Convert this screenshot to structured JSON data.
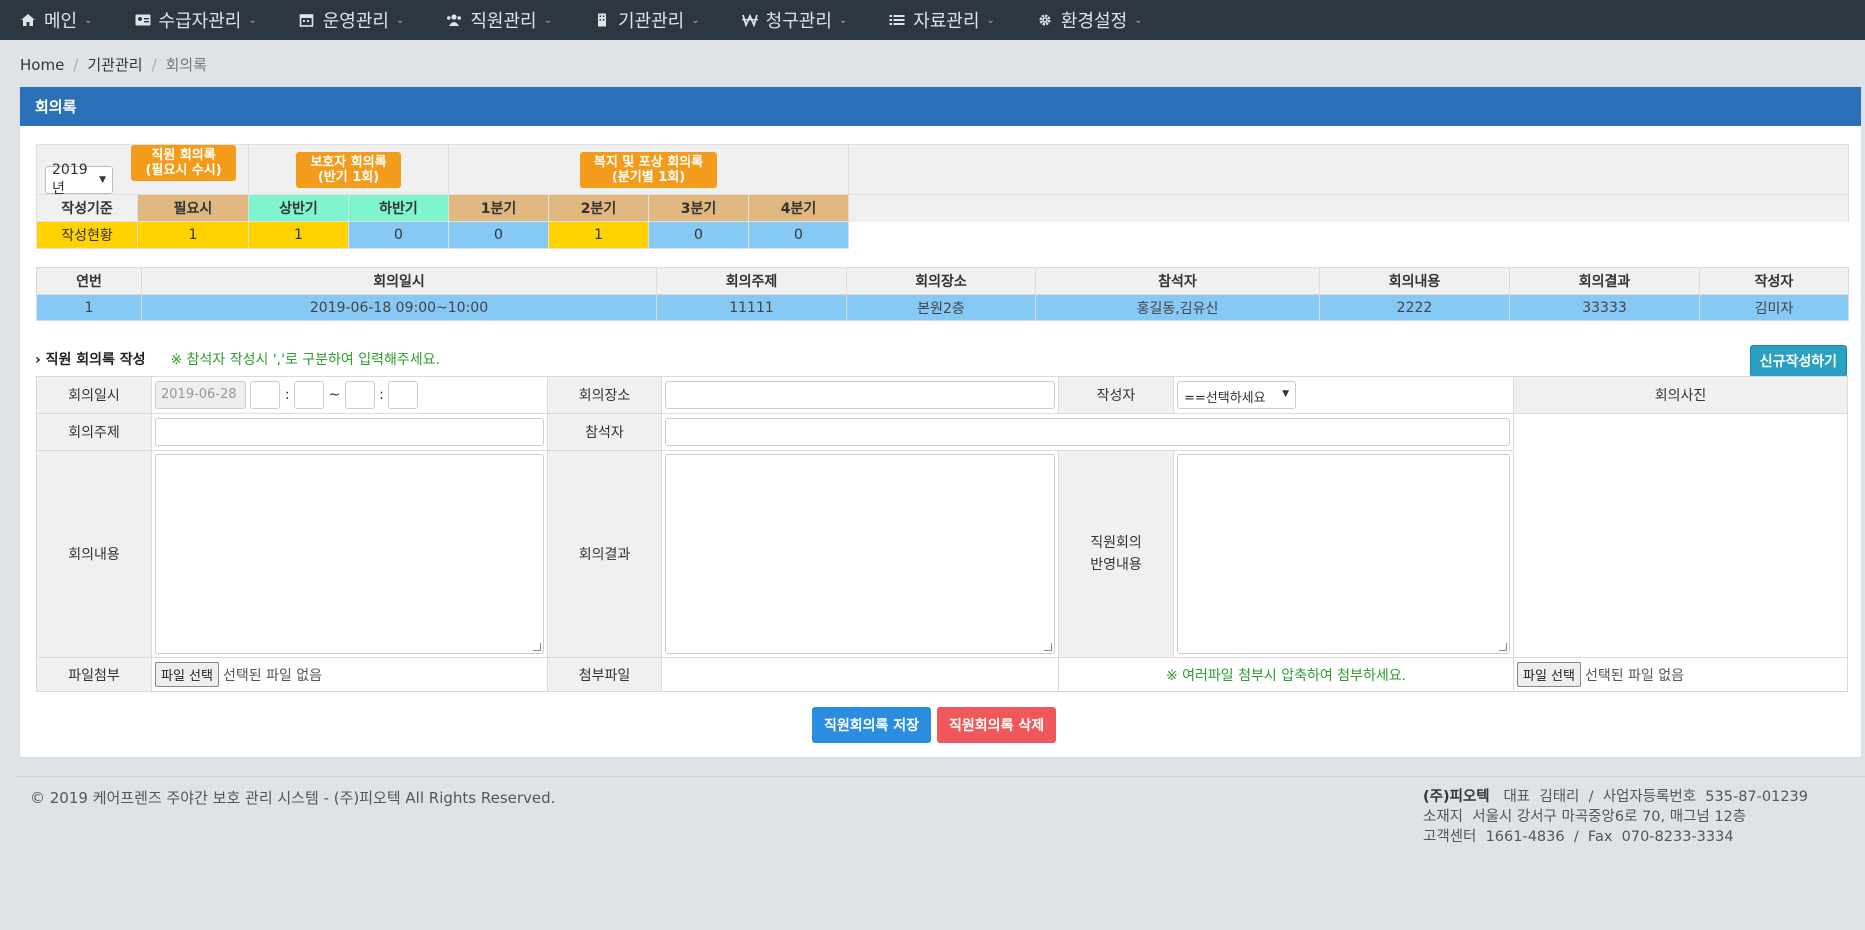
{
  "nav": {
    "items": [
      {
        "label": "메인",
        "icon": "home-icon"
      },
      {
        "label": "수급자관리",
        "icon": "id-card-icon"
      },
      {
        "label": "운영관리",
        "icon": "calendar-icon"
      },
      {
        "label": "직원관리",
        "icon": "users-icon"
      },
      {
        "label": "기관관리",
        "icon": "building-icon"
      },
      {
        "label": "청구관리",
        "icon": "won-icon"
      },
      {
        "label": "자료관리",
        "icon": "list-icon"
      },
      {
        "label": "환경설정",
        "icon": "gear-icon"
      }
    ]
  },
  "breadcrumb": {
    "home": "Home",
    "section": "기관관리",
    "current": "회의록"
  },
  "panel": {
    "title": "회의록"
  },
  "summary": {
    "year": "2019 년",
    "btn_staff_l1": "직원 회의록",
    "btn_staff_l2": "(필요시 수시)",
    "btn_guardian_l1": "보호자 회의록",
    "btn_guardian_l2": "(반기 1회)",
    "btn_welfare_l1": "복지 및 포상 회의록",
    "btn_welfare_l2": "(분기별 1회)",
    "criteria_label": "작성기준",
    "status_label": "작성현황",
    "headers": [
      "필요시",
      "상반기",
      "하반기",
      "1분기",
      "2분기",
      "3분기",
      "4분기"
    ],
    "values": [
      "1",
      "1",
      "0",
      "0",
      "1",
      "0",
      "0"
    ]
  },
  "list": {
    "headers": [
      "연번",
      "회의일시",
      "회의주제",
      "회의장소",
      "참석자",
      "회의내용",
      "회의결과",
      "작성자"
    ],
    "rows": [
      [
        "1",
        "2019-06-18 09:00~10:00",
        "11111",
        "본원2층",
        "홍길동,김유신",
        "2222",
        "33333",
        "김미자"
      ]
    ]
  },
  "form": {
    "section_title": "직원 회의록 작성",
    "note": "※ 참석자 작성시 ','로 구분하여 입력해주세요.",
    "new_button": "신규작성하기",
    "date_label": "회의일시",
    "date_value": "2019-06-28",
    "colon": ":",
    "tilde": "~",
    "place_label": "회의장소",
    "writer_label": "작성자",
    "writer_placeholder": "==선택하세요",
    "photo_label": "회의사진",
    "topic_label": "회의주제",
    "attendees_label": "참석자",
    "content_label": "회의내용",
    "result_label": "회의결과",
    "reflect_label_l1": "직원회의",
    "reflect_label_l2": "반영내용",
    "attach_label": "파일첨부",
    "file_btn": "파일 선택",
    "no_file": "선택된 파일 없음",
    "attached_label": "첨부파일",
    "attach_note": "※ 여러파일 첨부시 압축하여 첨부하세요."
  },
  "actions": {
    "save": "직원회의록 저장",
    "delete": "직원회의록 삭제"
  },
  "footer": {
    "copyright": "© 2019 케어프렌즈 주야간 보호 관리 시스템 - (주)피오텍 All Rights Reserved.",
    "company": "(주)피오텍",
    "line1": "대표  김태리  /  사업자등록번호  535-87-01239",
    "line2": "소재지  서울시 강서구 마곡중앙6로 70, 매그넘 12층",
    "line3": "고객센터  1661-4836  /  Fax  070-8233-3334"
  },
  "colors": {
    "navbar": "#2d3741",
    "panel_header": "#2b71b9",
    "orange": "#f39c1b",
    "tan": "#dfb77f",
    "mint": "#7ff5cf",
    "yellow": "#ffd200",
    "light_blue": "#86c9f5",
    "save": "#2b8de0",
    "delete": "#f0575a",
    "teal": "#2ba0c2"
  }
}
